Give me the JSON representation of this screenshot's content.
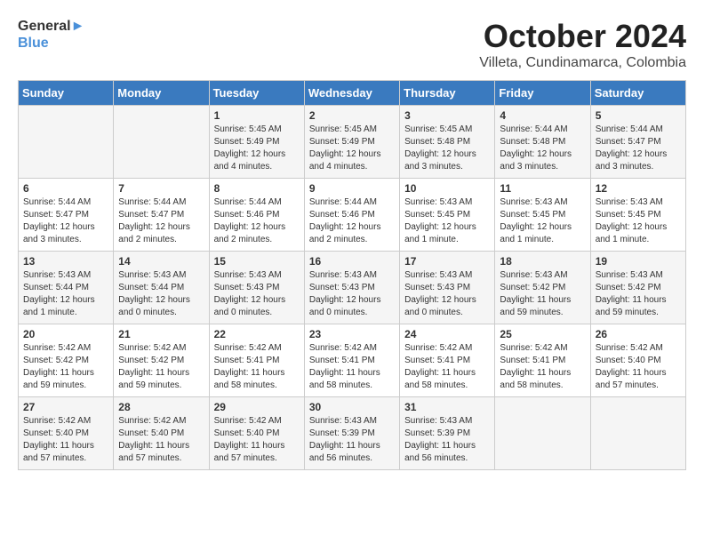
{
  "header": {
    "logo_general": "General",
    "logo_blue": "Blue",
    "title": "October 2024",
    "location": "Villeta, Cundinamarca, Colombia"
  },
  "weekdays": [
    "Sunday",
    "Monday",
    "Tuesday",
    "Wednesday",
    "Thursday",
    "Friday",
    "Saturday"
  ],
  "weeks": [
    [
      {
        "day": "",
        "info": ""
      },
      {
        "day": "",
        "info": ""
      },
      {
        "day": "1",
        "info": "Sunrise: 5:45 AM\nSunset: 5:49 PM\nDaylight: 12 hours and 4 minutes."
      },
      {
        "day": "2",
        "info": "Sunrise: 5:45 AM\nSunset: 5:49 PM\nDaylight: 12 hours and 4 minutes."
      },
      {
        "day": "3",
        "info": "Sunrise: 5:45 AM\nSunset: 5:48 PM\nDaylight: 12 hours and 3 minutes."
      },
      {
        "day": "4",
        "info": "Sunrise: 5:44 AM\nSunset: 5:48 PM\nDaylight: 12 hours and 3 minutes."
      },
      {
        "day": "5",
        "info": "Sunrise: 5:44 AM\nSunset: 5:47 PM\nDaylight: 12 hours and 3 minutes."
      }
    ],
    [
      {
        "day": "6",
        "info": "Sunrise: 5:44 AM\nSunset: 5:47 PM\nDaylight: 12 hours and 3 minutes."
      },
      {
        "day": "7",
        "info": "Sunrise: 5:44 AM\nSunset: 5:47 PM\nDaylight: 12 hours and 2 minutes."
      },
      {
        "day": "8",
        "info": "Sunrise: 5:44 AM\nSunset: 5:46 PM\nDaylight: 12 hours and 2 minutes."
      },
      {
        "day": "9",
        "info": "Sunrise: 5:44 AM\nSunset: 5:46 PM\nDaylight: 12 hours and 2 minutes."
      },
      {
        "day": "10",
        "info": "Sunrise: 5:43 AM\nSunset: 5:45 PM\nDaylight: 12 hours and 1 minute."
      },
      {
        "day": "11",
        "info": "Sunrise: 5:43 AM\nSunset: 5:45 PM\nDaylight: 12 hours and 1 minute."
      },
      {
        "day": "12",
        "info": "Sunrise: 5:43 AM\nSunset: 5:45 PM\nDaylight: 12 hours and 1 minute."
      }
    ],
    [
      {
        "day": "13",
        "info": "Sunrise: 5:43 AM\nSunset: 5:44 PM\nDaylight: 12 hours and 1 minute."
      },
      {
        "day": "14",
        "info": "Sunrise: 5:43 AM\nSunset: 5:44 PM\nDaylight: 12 hours and 0 minutes."
      },
      {
        "day": "15",
        "info": "Sunrise: 5:43 AM\nSunset: 5:43 PM\nDaylight: 12 hours and 0 minutes."
      },
      {
        "day": "16",
        "info": "Sunrise: 5:43 AM\nSunset: 5:43 PM\nDaylight: 12 hours and 0 minutes."
      },
      {
        "day": "17",
        "info": "Sunrise: 5:43 AM\nSunset: 5:43 PM\nDaylight: 12 hours and 0 minutes."
      },
      {
        "day": "18",
        "info": "Sunrise: 5:43 AM\nSunset: 5:42 PM\nDaylight: 11 hours and 59 minutes."
      },
      {
        "day": "19",
        "info": "Sunrise: 5:43 AM\nSunset: 5:42 PM\nDaylight: 11 hours and 59 minutes."
      }
    ],
    [
      {
        "day": "20",
        "info": "Sunrise: 5:42 AM\nSunset: 5:42 PM\nDaylight: 11 hours and 59 minutes."
      },
      {
        "day": "21",
        "info": "Sunrise: 5:42 AM\nSunset: 5:42 PM\nDaylight: 11 hours and 59 minutes."
      },
      {
        "day": "22",
        "info": "Sunrise: 5:42 AM\nSunset: 5:41 PM\nDaylight: 11 hours and 58 minutes."
      },
      {
        "day": "23",
        "info": "Sunrise: 5:42 AM\nSunset: 5:41 PM\nDaylight: 11 hours and 58 minutes."
      },
      {
        "day": "24",
        "info": "Sunrise: 5:42 AM\nSunset: 5:41 PM\nDaylight: 11 hours and 58 minutes."
      },
      {
        "day": "25",
        "info": "Sunrise: 5:42 AM\nSunset: 5:41 PM\nDaylight: 11 hours and 58 minutes."
      },
      {
        "day": "26",
        "info": "Sunrise: 5:42 AM\nSunset: 5:40 PM\nDaylight: 11 hours and 57 minutes."
      }
    ],
    [
      {
        "day": "27",
        "info": "Sunrise: 5:42 AM\nSunset: 5:40 PM\nDaylight: 11 hours and 57 minutes."
      },
      {
        "day": "28",
        "info": "Sunrise: 5:42 AM\nSunset: 5:40 PM\nDaylight: 11 hours and 57 minutes."
      },
      {
        "day": "29",
        "info": "Sunrise: 5:42 AM\nSunset: 5:40 PM\nDaylight: 11 hours and 57 minutes."
      },
      {
        "day": "30",
        "info": "Sunrise: 5:43 AM\nSunset: 5:39 PM\nDaylight: 11 hours and 56 minutes."
      },
      {
        "day": "31",
        "info": "Sunrise: 5:43 AM\nSunset: 5:39 PM\nDaylight: 11 hours and 56 minutes."
      },
      {
        "day": "",
        "info": ""
      },
      {
        "day": "",
        "info": ""
      }
    ]
  ]
}
